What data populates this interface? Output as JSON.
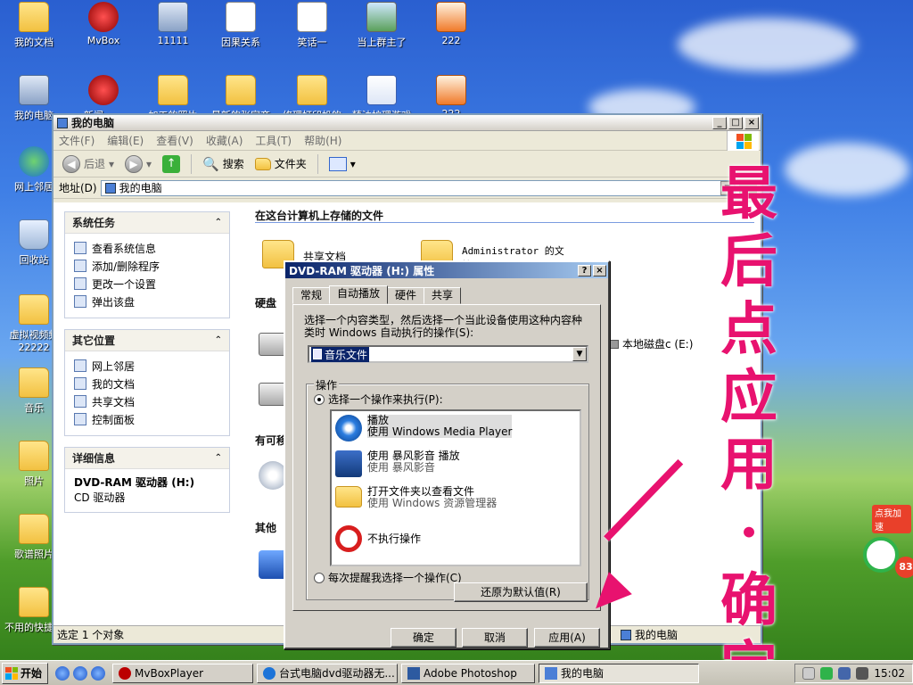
{
  "desktop": {
    "icons": [
      {
        "label": "我的文档",
        "kind": "folder"
      },
      {
        "label": "MvBox",
        "kind": "red"
      },
      {
        "label": "11111",
        "kind": "pc"
      },
      {
        "label": "因果关系",
        "kind": "doc"
      },
      {
        "label": "笑话一",
        "kind": "doc"
      },
      {
        "label": "当上群主了",
        "kind": "img"
      },
      {
        "label": "222",
        "kind": "box"
      },
      {
        "label": "我的电脑",
        "kind": "pc"
      },
      {
        "label": "新闻cuw",
        "kind": "red"
      },
      {
        "label": "加工的照片",
        "kind": "folder"
      },
      {
        "label": "最新的张家齐",
        "kind": "folder"
      },
      {
        "label": "修理打印机的",
        "kind": "folder"
      },
      {
        "label": "精油护理游戏",
        "kind": "word"
      },
      {
        "label": "222",
        "kind": "box"
      },
      {
        "label": "网上邻居",
        "kind": "net"
      },
      {
        "label": "回收站",
        "kind": "bin"
      },
      {
        "label": "虚拟视频频 22222",
        "kind": "folder"
      },
      {
        "label": "音乐",
        "kind": "folder"
      },
      {
        "label": "照片",
        "kind": "folder"
      },
      {
        "label": "歌谱照片",
        "kind": "folder"
      },
      {
        "label": "不用的快捷单",
        "kind": "folder"
      }
    ]
  },
  "explorer": {
    "title": "我的电脑",
    "menu": [
      "文件(F)",
      "编辑(E)",
      "查看(V)",
      "收藏(A)",
      "工具(T)",
      "帮助(H)"
    ],
    "toolbar": {
      "back": "后退",
      "search": "搜索",
      "folders": "文件夹"
    },
    "address_label": "地址(D)",
    "address_value": "我的电脑",
    "system_tasks": {
      "title": "系统任务",
      "items": [
        "查看系统信息",
        "添加/删除程序",
        "更改一个设置",
        "弹出该盘"
      ]
    },
    "other_places": {
      "title": "其它位置",
      "items": [
        "网上邻居",
        "我的文档",
        "共享文档",
        "控制面板"
      ]
    },
    "details": {
      "title": "详细信息",
      "name": "DVD-RAM 驱动器 (H:)",
      "type": "CD 驱动器"
    },
    "sections": {
      "stored_files": "在这台计算机上存储的文件",
      "hard_disks": "硬盘",
      "removable": "有可移",
      "other": "其他"
    },
    "files": {
      "shared_docs": "共享文档",
      "admin_docs": "Administrator 的文档"
    },
    "local_disk_e": "本地磁盘c (E:)",
    "status_left": "选定 1 个对象",
    "status_right": "我的电脑"
  },
  "dialog": {
    "title": "DVD-RAM 驱动器 (H:) 属性",
    "tabs": [
      "常规",
      "自动播放",
      "硬件",
      "共享"
    ],
    "active_tab": "自动播放",
    "instruction": "选择一个内容类型，然后选择一个当此设备使用这种内容种类时 Windows 自动执行的操作(S):",
    "content_type": "音乐文件",
    "group_label": "操作",
    "radio_select": "选择一个操作来执行(P):",
    "actions": [
      {
        "title": "播放",
        "subtitle": "使用 Windows Media Player"
      },
      {
        "title": "使用 暴风影音 播放",
        "subtitle": "使用 暴风影音"
      },
      {
        "title": "打开文件夹以查看文件",
        "subtitle": "使用 Windows 资源管理器"
      },
      {
        "title": "不执行操作",
        "subtitle": ""
      }
    ],
    "radio_prompt": "每次提醒我选择一个操作(C)",
    "restore_defaults": "还原为默认值(R)",
    "ok": "确定",
    "cancel": "取消",
    "apply": "应用(A)"
  },
  "annotation": {
    "text": "最后点应用·确定",
    "color": "#e8126f"
  },
  "gadget": {
    "label": "点我加速",
    "value": "83"
  },
  "taskbar": {
    "start": "开始",
    "tasks": [
      "MvBoxPlayer",
      "台式电脑dvd驱动器无...",
      "Adobe Photoshop",
      "我的电脑"
    ],
    "clock": "15:02"
  }
}
